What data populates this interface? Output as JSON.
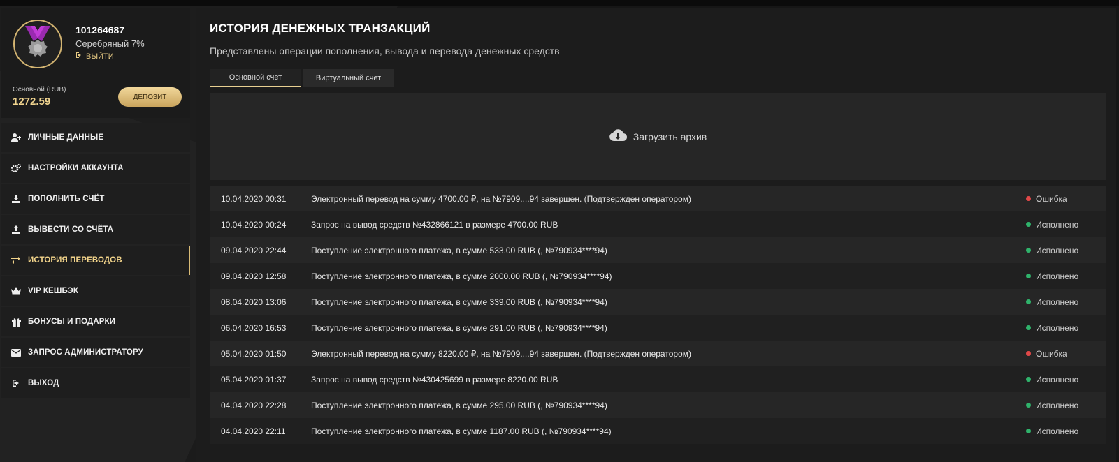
{
  "colors": {
    "accent": "#e8cf91",
    "error": "#e04848",
    "success": "#2fb36b"
  },
  "profile": {
    "user_id": "101264687",
    "level": "Серебряный 7%",
    "logout_link": "ВЫЙТИ",
    "balance_label": "Основной (RUB)",
    "balance_value": "1272.59",
    "deposit_button": "ДЕПОЗИТ"
  },
  "nav": [
    {
      "label": "ЛИЧНЫЕ ДАННЫЕ",
      "icon": "user-plus-icon"
    },
    {
      "label": "НАСТРОЙКИ АККАУНТА",
      "icon": "gears-icon"
    },
    {
      "label": "ПОПОЛНИТЬ СЧЁТ",
      "icon": "download-icon"
    },
    {
      "label": "ВЫВЕСТИ СО СЧЁТА",
      "icon": "upload-icon"
    },
    {
      "label": "ИСТОРИЯ ПЕРЕВОДОВ",
      "icon": "transfer-arrows-icon",
      "active": true
    },
    {
      "label": "VIP КЕШБЭК",
      "icon": "crown-icon"
    },
    {
      "label": "БОНУСЫ И ПОДАРКИ",
      "icon": "gift-icon"
    },
    {
      "label": "ЗАПРОС АДМИНИСТРАТОРУ",
      "icon": "envelope-icon"
    },
    {
      "label": "ВЫХОД",
      "icon": "sign-out-icon"
    }
  ],
  "main": {
    "title": "ИСТОРИЯ ДЕНЕЖНЫХ ТРАНЗАКЦИЙ",
    "subtitle": "Представлены операции пополнения, вывода и перевода денежных средств",
    "tabs": [
      {
        "label": "Основной счет",
        "active": true
      },
      {
        "label": "Виртуальный счет",
        "active": false
      }
    ],
    "archive_label": "Загрузить архив"
  },
  "transactions": [
    {
      "date": "10.04.2020 00:31",
      "desc": "Электронный перевод на сумму 4700.00 ₽, на №7909....94 завершен. (Подтвержден оператором)",
      "status": "Ошибка",
      "state": "error"
    },
    {
      "date": "10.04.2020 00:24",
      "desc": "Запрос на вывод средств №432866121 в размере 4700.00 RUB",
      "status": "Исполнено",
      "state": "success"
    },
    {
      "date": "09.04.2020 22:44",
      "desc": "Поступление электронного платежа, в сумме 533.00 RUB (, №790934****94)",
      "status": "Исполнено",
      "state": "success"
    },
    {
      "date": "09.04.2020 12:58",
      "desc": "Поступление электронного платежа, в сумме 2000.00 RUB (, №790934****94)",
      "status": "Исполнено",
      "state": "success"
    },
    {
      "date": "08.04.2020 13:06",
      "desc": "Поступление электронного платежа, в сумме 339.00 RUB (, №790934****94)",
      "status": "Исполнено",
      "state": "success"
    },
    {
      "date": "06.04.2020 16:53",
      "desc": "Поступление электронного платежа, в сумме 291.00 RUB (, №790934****94)",
      "status": "Исполнено",
      "state": "success"
    },
    {
      "date": "05.04.2020 01:50",
      "desc": "Электронный перевод на сумму 8220.00 ₽, на №7909....94 завершен. (Подтвержден оператором)",
      "status": "Ошибка",
      "state": "error"
    },
    {
      "date": "05.04.2020 01:37",
      "desc": "Запрос на вывод средств №430425699 в размере 8220.00 RUB",
      "status": "Исполнено",
      "state": "success"
    },
    {
      "date": "04.04.2020 22:28",
      "desc": "Поступление электронного платежа, в сумме 295.00 RUB (, №790934****94)",
      "status": "Исполнено",
      "state": "success"
    },
    {
      "date": "04.04.2020 22:11",
      "desc": "Поступление электронного платежа, в сумме 1187.00 RUB (, №790934****94)",
      "status": "Исполнено",
      "state": "success"
    }
  ]
}
